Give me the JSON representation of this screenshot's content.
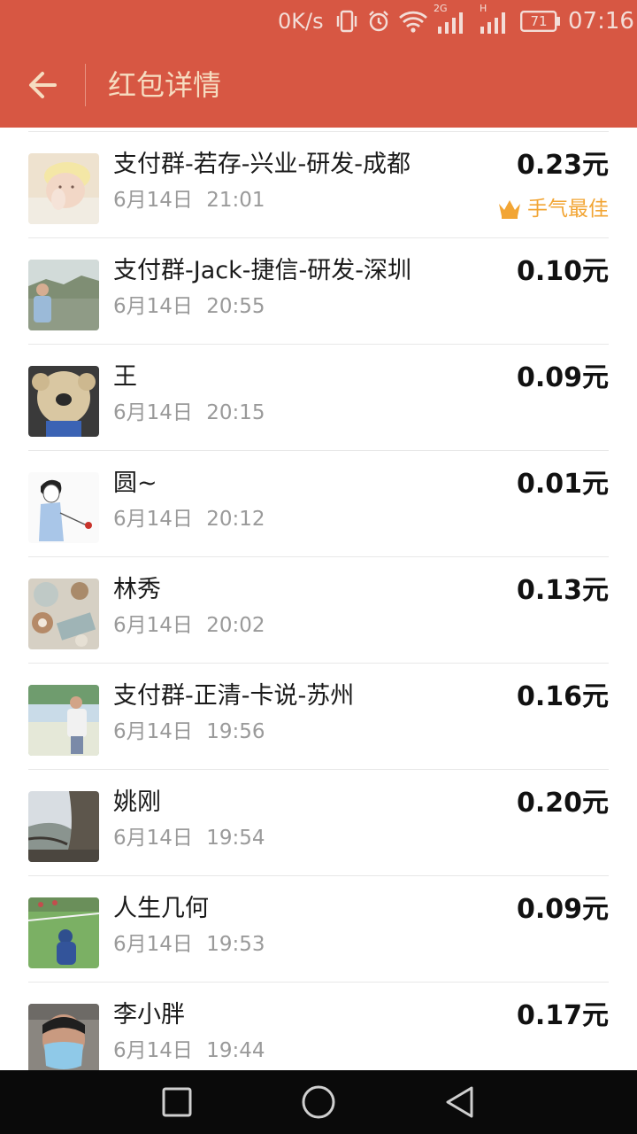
{
  "status_bar": {
    "net_speed": "0K/s",
    "network_2g": "2G",
    "network_h": "H",
    "battery": "71",
    "time": "07:16"
  },
  "app_bar": {
    "title": "红包详情",
    "back_icon": "arrow-left-icon"
  },
  "records": [
    {
      "name": "支付群-若存-兴业-研发-成都",
      "time": "6月14日 21:01",
      "amount": "0.23元",
      "best_label": "手气最佳",
      "avatar": "baby-photo"
    },
    {
      "name": "支付群-Jack-捷信-研发-深圳",
      "time": "6月14日 20:55",
      "amount": "0.10元",
      "avatar": "man-great-wall"
    },
    {
      "name": "王",
      "time": "6月14日 20:15",
      "amount": "0.09元",
      "avatar": "teddy-bear"
    },
    {
      "name": "圆~",
      "time": "6月14日 20:12",
      "amount": "0.01元",
      "avatar": "cartoon-boy-rose"
    },
    {
      "name": "林秀",
      "time": "6月14日 20:02",
      "amount": "0.13元",
      "avatar": "desk-still-life"
    },
    {
      "name": "支付群-正清-卡说-苏州",
      "time": "6月14日 19:56",
      "amount": "0.16元",
      "avatar": "man-by-river"
    },
    {
      "name": "姚刚",
      "time": "6月14日 19:54",
      "amount": "0.20元",
      "avatar": "mountain-cliff"
    },
    {
      "name": "人生几何",
      "time": "6月14日 19:53",
      "amount": "0.09元",
      "avatar": "child-on-field"
    },
    {
      "name": "李小胖",
      "time": "6月14日 19:44",
      "amount": "0.17元",
      "avatar": "man-face-mask"
    }
  ],
  "colors": {
    "header_bg": "#d75743",
    "title_text": "#f6dcc0",
    "best_gold": "#f2a534",
    "secondary_text": "#9a9a9a"
  },
  "nav_bar": {
    "icons": [
      "square-recents-icon",
      "circle-home-icon",
      "triangle-back-icon"
    ]
  }
}
